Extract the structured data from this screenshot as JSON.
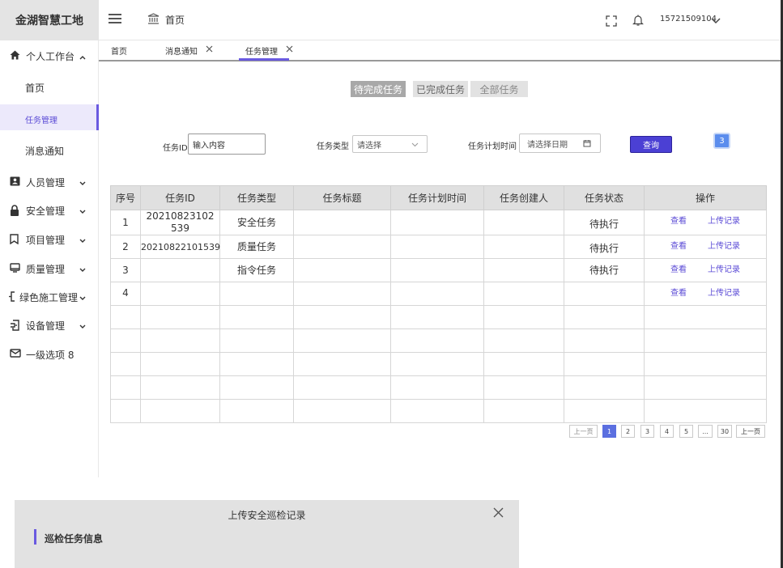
{
  "app": {
    "title": "金湖智慧工地"
  },
  "header": {
    "breadcrumb": "首页",
    "user": "15721509104",
    "icons": [
      "menu-icon",
      "home-icon",
      "fullscreen-icon",
      "bell-icon",
      "chevron-down-icon"
    ]
  },
  "sidebar": {
    "items": [
      {
        "label": "个人工作台",
        "icon": "home-icon",
        "expanded": true
      },
      {
        "label": "首页"
      },
      {
        "label": "任务管理",
        "active": true
      },
      {
        "label": "消息通知"
      },
      {
        "label": "人员管理",
        "icon": "id-card-icon"
      },
      {
        "label": "安全管理",
        "icon": "lock-icon"
      },
      {
        "label": "项目管理",
        "icon": "bookmark-icon"
      },
      {
        "label": "质量管理",
        "icon": "monitor-icon"
      },
      {
        "label": "绿色施工管理",
        "icon": "leaf-icon"
      },
      {
        "label": "设备管理",
        "icon": "device-icon"
      },
      {
        "label": "一级选项 8",
        "icon": "mail-icon"
      }
    ]
  },
  "tabs": [
    {
      "label": "首页"
    },
    {
      "label": "消息通知",
      "closable": true
    },
    {
      "label": "任务管理",
      "closable": true,
      "active": true
    }
  ],
  "segments": [
    "待完成任务",
    "已完成任务",
    "全部任务"
  ],
  "filters": {
    "task_id_label": "任务ID",
    "task_id_value": "输入内容",
    "task_type_label": "任务类型",
    "task_type_placeholder": "请选择",
    "plan_time_label": "任务计划时间",
    "plan_time_placeholder": "请选择日期",
    "query_label": "查询",
    "badge": "3"
  },
  "table": {
    "columns": [
      "序号",
      "任务ID",
      "任务类型",
      "任务标题",
      "任务计划时间",
      "任务创建人",
      "任务状态",
      "操作"
    ],
    "rows": [
      {
        "no": "1",
        "id": "20210823102539",
        "type": "安全任务",
        "title": "",
        "time": "",
        "creator": "",
        "status": "待执行",
        "view": "查看",
        "upload": "上传记录"
      },
      {
        "no": "2",
        "id": "20210822101539",
        "type": "质量任务",
        "title": "",
        "time": "",
        "creator": "",
        "status": "待执行",
        "view": "查看",
        "upload": "上传记录"
      },
      {
        "no": "3",
        "id": "",
        "type": "指令任务",
        "title": "",
        "time": "",
        "creator": "",
        "status": "待执行",
        "view": "查看",
        "upload": "上传记录"
      },
      {
        "no": "4",
        "id": "",
        "type": "",
        "title": "",
        "time": "",
        "creator": "",
        "status": "",
        "view": "查看",
        "upload": "上传记录"
      }
    ],
    "empty_rows": 5
  },
  "pagination": {
    "prev": "上一页",
    "pages": [
      "1",
      "2",
      "3",
      "4",
      "5",
      "...",
      "30"
    ],
    "current": "1",
    "next": "上一页"
  },
  "modal": {
    "title": "上传安全巡检记录",
    "section": "巡检任务信息"
  },
  "colors": {
    "accent": "#6a5ae0",
    "query_button": "#4b40d4",
    "badge": "#5b8ded",
    "pager_current": "#5b6fe0"
  }
}
